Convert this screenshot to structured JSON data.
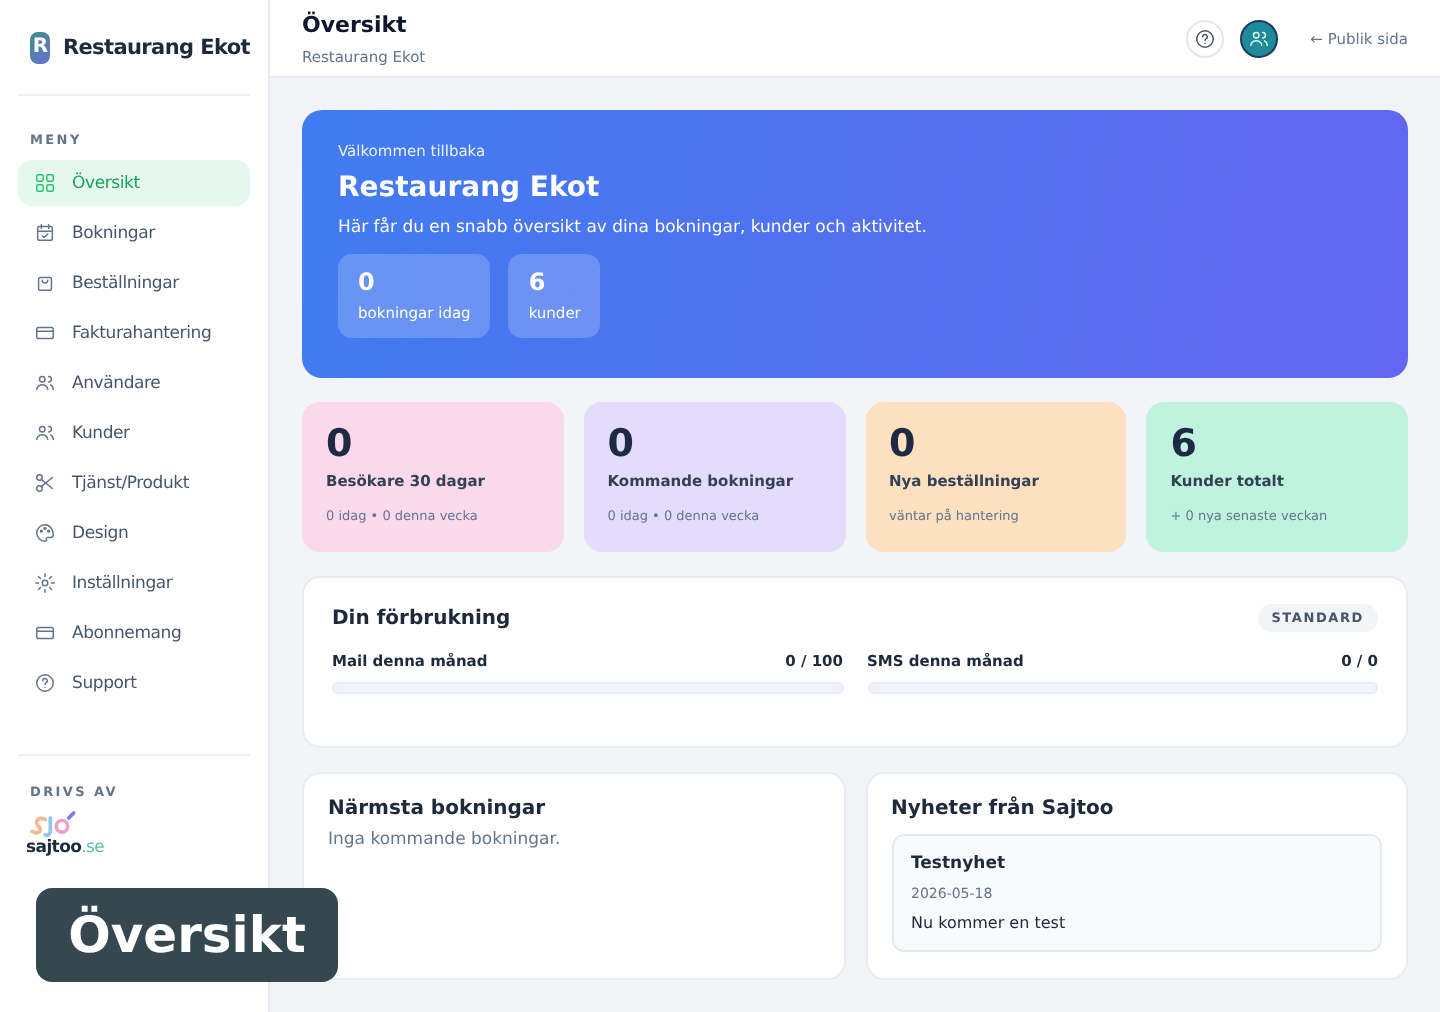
{
  "sidebar": {
    "brand": "Restaurang Ekot",
    "logo_letter": "R",
    "section": "MENY",
    "items": [
      {
        "label": "Översikt",
        "selected": true
      },
      {
        "label": "Bokningar",
        "selected": false
      },
      {
        "label": "Beställningar",
        "selected": false
      },
      {
        "label": "Fakturahantering",
        "selected": false
      },
      {
        "label": "Användare",
        "selected": false
      },
      {
        "label": "Kunder",
        "selected": false
      },
      {
        "label": "Tjänst/Produkt",
        "selected": false
      },
      {
        "label": "Design",
        "selected": false
      },
      {
        "label": "Inställningar",
        "selected": false
      },
      {
        "label": "Abonnemang",
        "selected": false
      },
      {
        "label": "Support",
        "selected": false
      }
    ],
    "powered_by": "DRIVS AV",
    "partner_logo_text": "sajtoo",
    "partner_logo_suffix": ".se"
  },
  "header": {
    "title": "Översikt",
    "subtitle": "Restaurang Ekot",
    "public_link": "← Publik sida"
  },
  "hero": {
    "greeting": "Välkommen tillbaka",
    "title": "Restaurang Ekot",
    "text": "Här får du en snabb översikt av dina bokningar, kunder och aktivitet.",
    "stats": [
      {
        "value": "0",
        "label": "bokningar idag"
      },
      {
        "value": "6",
        "label": "kunder"
      }
    ]
  },
  "stat_cards": [
    {
      "value": "0",
      "label": "Besökare 30 dagar",
      "note": "0 idag • 0 denna vecka",
      "color": "#fbd9ec"
    },
    {
      "value": "0",
      "label": "Kommande bokningar",
      "note": "0 idag • 0 denna vecka",
      "color": "#e3ddfb"
    },
    {
      "value": "0",
      "label": "Nya beställningar",
      "note": "väntar på hantering",
      "color": "#fde0c0"
    },
    {
      "value": "6",
      "label": "Kunder totalt",
      "note": "+ 0 nya senaste veckan",
      "color": "#bff3df"
    }
  ],
  "usage": {
    "title": "Din förbrukning",
    "plan": "STANDARD",
    "meters": [
      {
        "label": "Mail denna månad",
        "reading": "0 / 100",
        "level": 0
      },
      {
        "label": "SMS denna månad",
        "reading": "0 / 0",
        "level": 0
      }
    ]
  },
  "upcoming": {
    "title": "Närmsta bokningar",
    "empty": "Inga kommande bokningar."
  },
  "news": {
    "title": "Nyheter från Sajtoo",
    "items": [
      {
        "title": "Testnyhet",
        "date": "2026-05-18",
        "text": "Nu kommer en test"
      }
    ]
  },
  "tooltip": {
    "text": "Översikt"
  }
}
